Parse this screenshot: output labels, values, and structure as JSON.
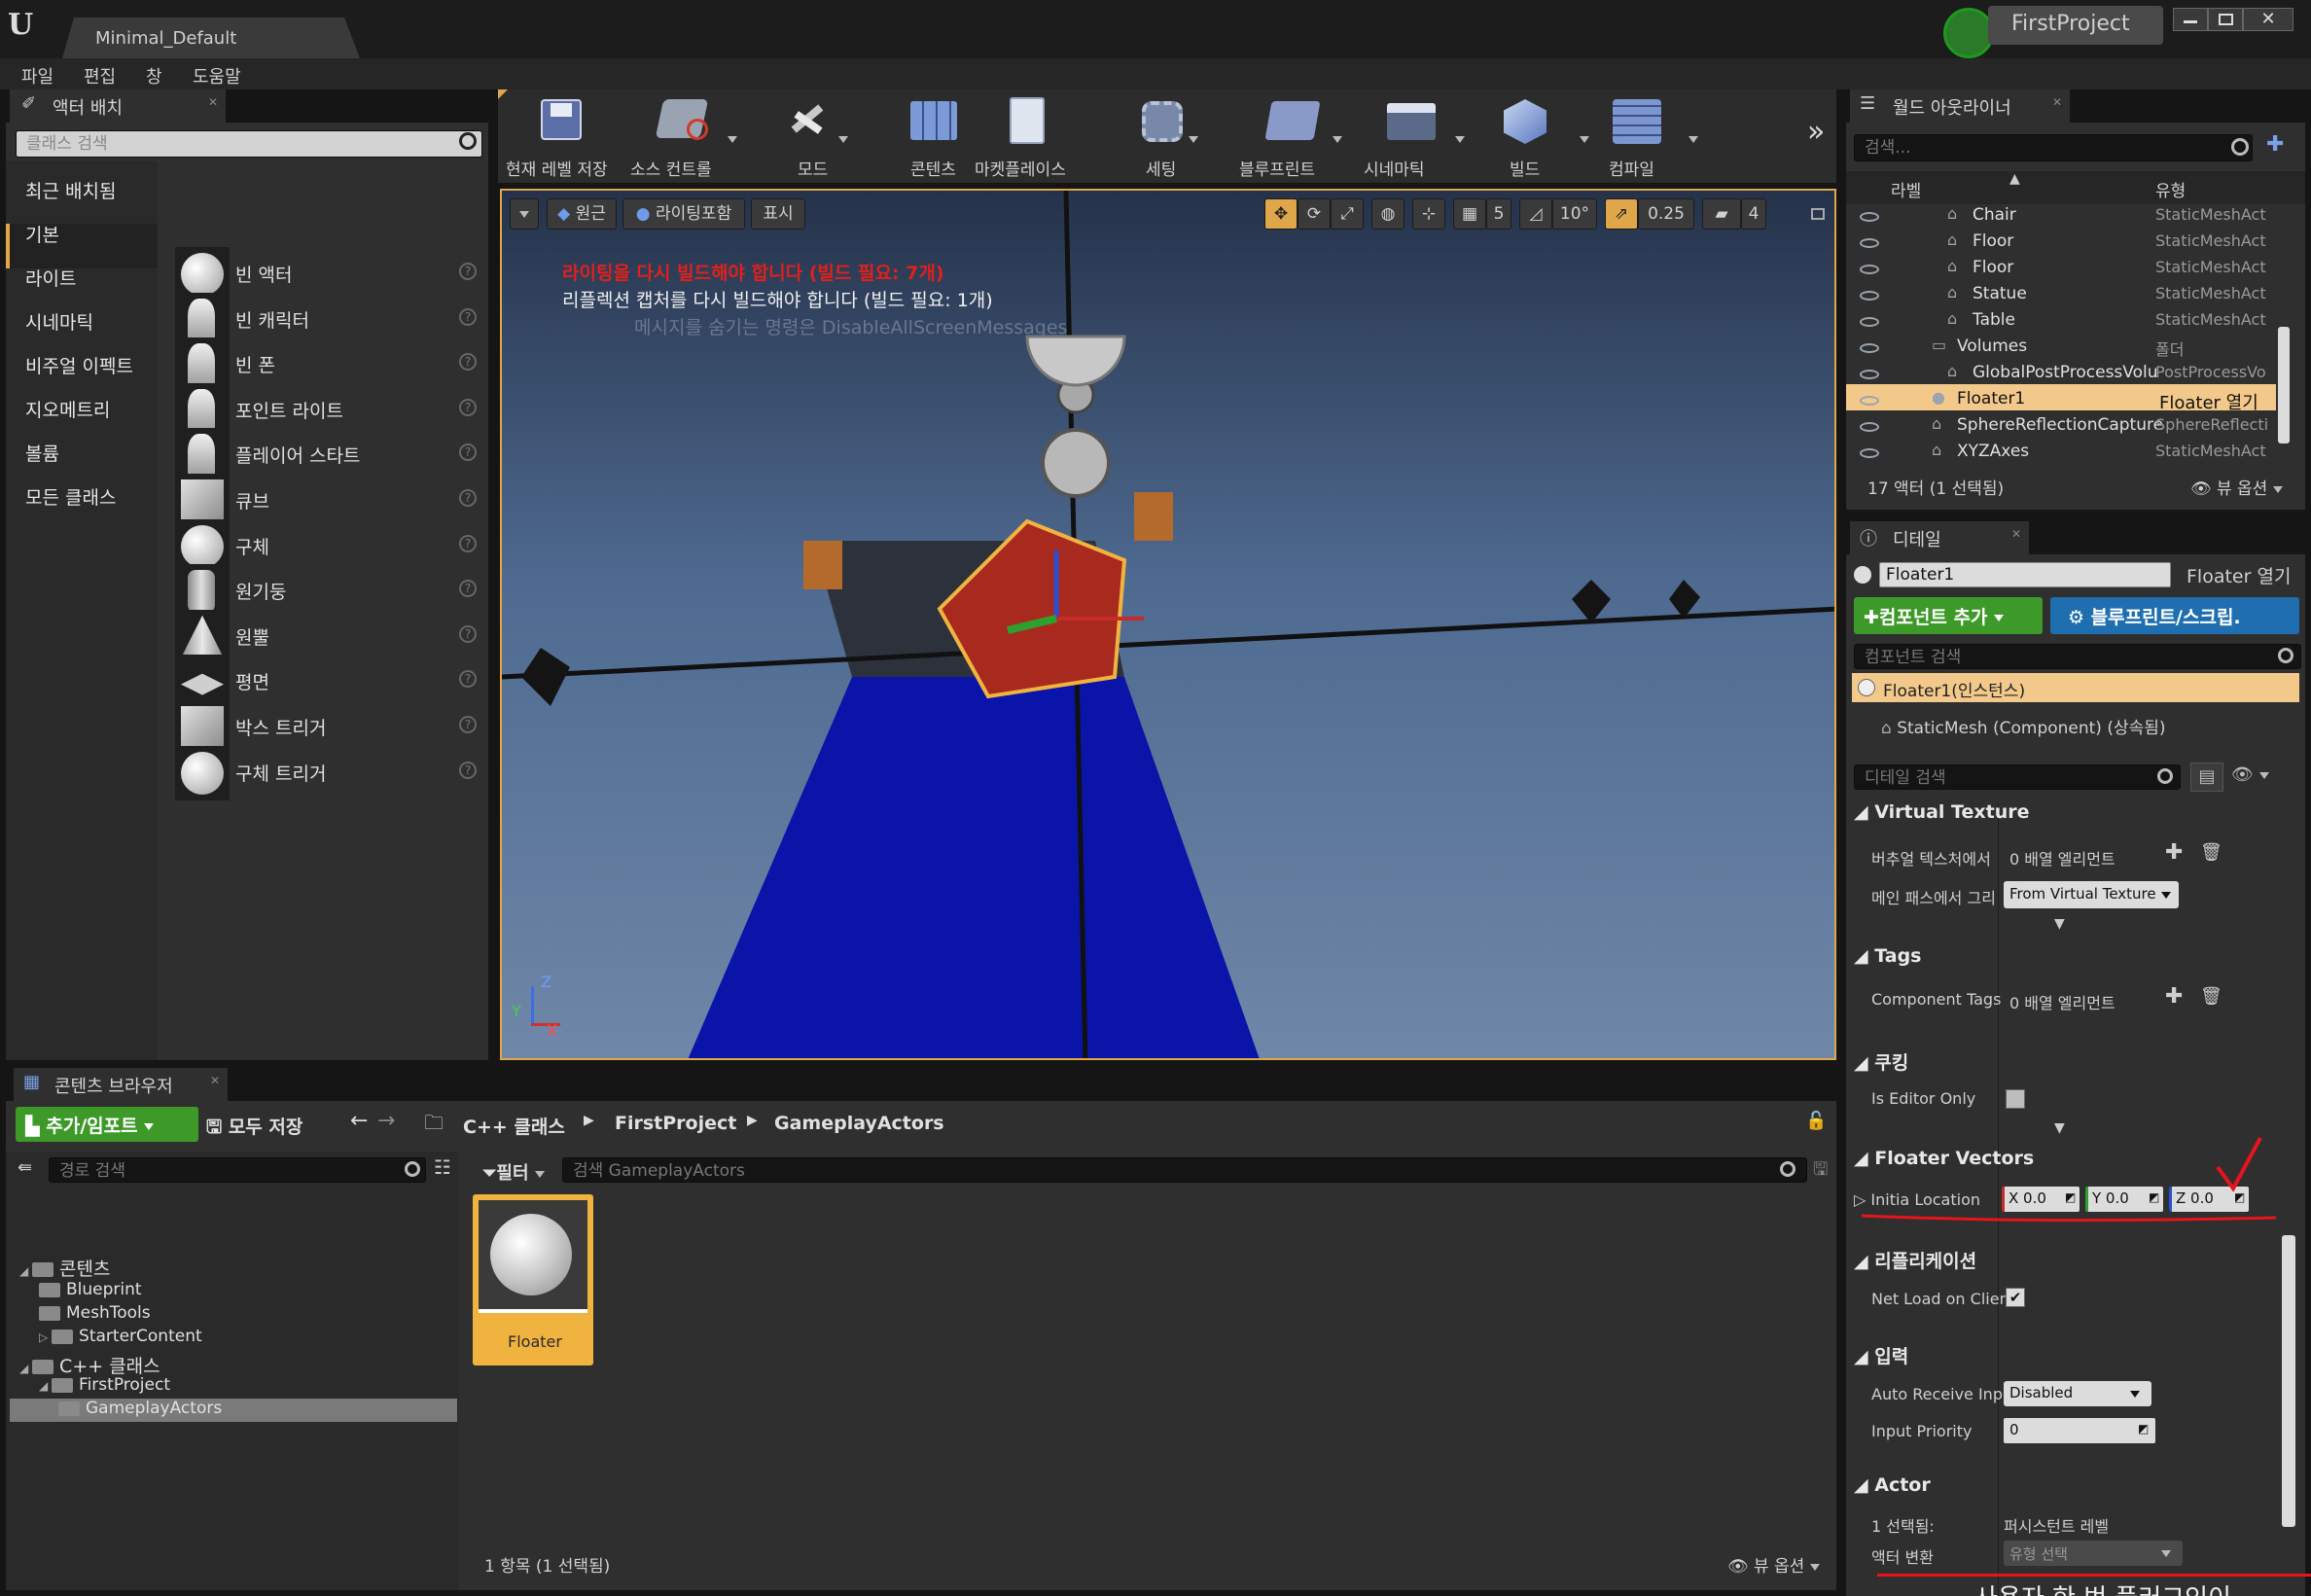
{
  "title_bar": {
    "tab": "Minimal_Default",
    "project": "FirstProject"
  },
  "menu": [
    "파일",
    "편집",
    "창",
    "도움말"
  ],
  "place_actors": {
    "tab": "액터 배치",
    "search_placeholder": "클래스 검색",
    "categories": [
      "최근 배치됨",
      "기본",
      "라이트",
      "시네마틱",
      "비주얼 이펙트",
      "지오메트리",
      "볼륨",
      "모든 클래스"
    ],
    "selected_category": "기본",
    "items": [
      "빈 액터",
      "빈 캐릭터",
      "빈 폰",
      "포인트 라이트",
      "플레이어 스타트",
      "큐브",
      "구체",
      "원기둥",
      "원뿔",
      "평면",
      "박스 트리거",
      "구체 트리거"
    ]
  },
  "toolbar": {
    "save": "현재 레벨 저장",
    "source_control": "소스 컨트롤",
    "modes": "모드",
    "content": "콘텐츠",
    "marketplace": "마켓플레이스",
    "settings": "세팅",
    "blueprints": "블루프린트",
    "cinematics": "시네마틱",
    "build": "빌드",
    "compile": "컴파일"
  },
  "viewport": {
    "perspective": "원근",
    "lit": "라이팅포함",
    "show": "표시",
    "grid_snap": "5",
    "rot_snap": "10°",
    "scale_snap": "0.25",
    "cam_speed": "4",
    "warning1": "라이팅을 다시 빌드해야 합니다 (빌드 필요: 7개)",
    "warning2": "리플렉션 캡처를 다시 빌드해야 합니다 (빌드 필요: 1개)",
    "warning3": "메시지를 숨기는 명령은 DisableAllScreenMessages",
    "axis_z": "Z",
    "axis_x": "X",
    "axis_y": "Y"
  },
  "world_outliner": {
    "tab": "월드 아웃라이너",
    "search_placeholder": "검색...",
    "col_label": "라벨",
    "col_type": "유형",
    "rows": [
      {
        "label": "Chair",
        "type": "StaticMeshAct"
      },
      {
        "label": "Floor",
        "type": "StaticMeshAct"
      },
      {
        "label": "Floor",
        "type": "StaticMeshAct"
      },
      {
        "label": "Statue",
        "type": "StaticMeshAct"
      },
      {
        "label": "Table",
        "type": "StaticMeshAct"
      },
      {
        "label": "Volumes",
        "type": "폴더"
      },
      {
        "label": "GlobalPostProcessVolu",
        "type": "PostProcessVo"
      },
      {
        "label": "Floater1",
        "type": "Floater 열기"
      },
      {
        "label": "SphereReflectionCapture",
        "type": "SphereReflecti"
      },
      {
        "label": "XYZAxes",
        "type": "StaticMeshAct"
      }
    ],
    "count": "17 액터 (1 선택됨)",
    "view_options": "뷰 옵션"
  },
  "details": {
    "tab": "디테일",
    "name": "Floater1",
    "open_link": "Floater 열기",
    "add_component": "컴포넌트 추가",
    "blueprint_script": "블루프린트/스크립.",
    "component_search": "컴포넌트 검색",
    "instance": "Floater1(인스턴스)",
    "static_mesh": "StaticMesh (Component) (상속됨)",
    "detail_search": "디테일 검색",
    "sections": {
      "virtual_texture": "Virtual Texture",
      "tags": "Tags",
      "cooking": "쿠킹",
      "floater_vectors": "Floater Vectors",
      "replication": "리플리케이션",
      "input": "입력",
      "actor": "Actor"
    },
    "vt_label": "버추얼 텍스처에서",
    "vt_value": "0 배열 엘리먼트",
    "main_pass_label": "메인 패스에서 그리",
    "main_pass_value": "From Virtual Texture",
    "component_tags_label": "Component Tags",
    "component_tags_value": "0 배열 엘리먼트",
    "editor_only_label": "Is Editor Only",
    "initial_location_label": "Initia Location",
    "loc_x": "X  0.0",
    "loc_y": "Y  0.0",
    "loc_z": "Z  0.0",
    "net_load_label": "Net Load on Client",
    "auto_receive_label": "Auto Receive Input",
    "auto_receive_value": "Disabled",
    "input_priority_label": "Input Priority",
    "input_priority_value": "0",
    "selected_label": "1 선택됨:",
    "selected_value": "퍼시스턴트 레벨",
    "actor_transform_label": "액터 변환",
    "actor_transform_value": "유형 선택",
    "subtitle": "사용자  한 번 플러그인이"
  },
  "content_browser": {
    "tab": "콘텐츠 브라우저",
    "add_import": "추가/임포트",
    "save_all": "모두 저장",
    "path": [
      "C++ 클래스",
      "FirstProject",
      "GameplayActors"
    ],
    "path_search": "경로 검색",
    "filter": "필터",
    "search_placeholder": "검색 GameplayActors",
    "tree": [
      {
        "label": "콘텐츠",
        "level": 0
      },
      {
        "label": "Blueprint",
        "level": 1
      },
      {
        "label": "MeshTools",
        "level": 1
      },
      {
        "label": "StarterContent",
        "level": 1
      },
      {
        "label": "C++ 클래스",
        "level": 0
      },
      {
        "label": "FirstProject",
        "level": 1
      },
      {
        "label": "GameplayActors",
        "level": 2
      }
    ],
    "asset": "Floater",
    "status": "1 항목 (1 선택됨)",
    "view_options": "뷰 옵션"
  },
  "colors": {
    "accent_orange": "#e0a64a",
    "selection": "#f0b340",
    "add_green": "#3d9a29",
    "blueprint_blue": "#1f6fb0",
    "warning_red": "#e0201c",
    "annotation_red": "#e8141c"
  }
}
